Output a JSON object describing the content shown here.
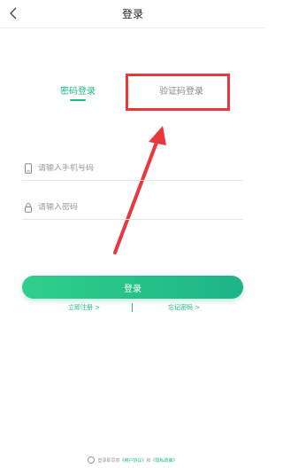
{
  "header": {
    "title": "登录"
  },
  "tabs": [
    {
      "label": "密码登录"
    },
    {
      "label": "验证码登录"
    }
  ],
  "form": {
    "phone_placeholder": "请输入手机号码",
    "password_placeholder": "请输入密码",
    "login_label": "登录"
  },
  "links": {
    "register": "立即注册 >",
    "forgot": "忘记密码 >"
  },
  "agreement": {
    "prefix": "登录即同意",
    "user_agreement": "《用户协议》",
    "and": "和",
    "privacy_policy": "《隐私政策》"
  },
  "colors": {
    "accent": "#1fb97f",
    "annotation": "#e8383d"
  },
  "icons": [
    "back-icon",
    "phone-icon",
    "lock-icon",
    "radio-icon"
  ]
}
